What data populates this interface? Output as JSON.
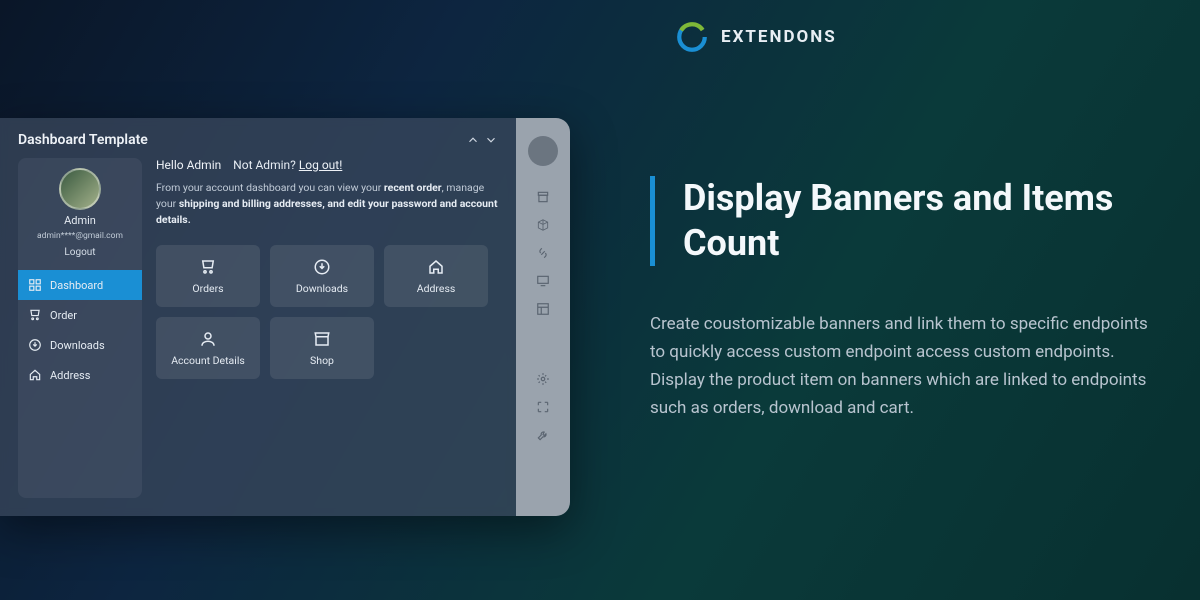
{
  "brand": {
    "name": "EXTENDONS"
  },
  "marketing": {
    "headline": "Display Banners and Items Count",
    "body": "Create coustomizable banners and link them to specific endpoints to quickly access custom endpoint access custom endpoints. Display the product item on banners which are linked to endpoints such as orders, download and cart."
  },
  "panel": {
    "title": "Dashboard Template",
    "profile": {
      "name": "Admin",
      "email": "admin****@gmail.com",
      "logout": "Logout"
    },
    "sidenav": [
      {
        "label": "Dashboard",
        "icon": "grid",
        "active": true
      },
      {
        "label": "Order",
        "icon": "cart",
        "active": false
      },
      {
        "label": "Downloads",
        "icon": "download",
        "active": false
      },
      {
        "label": "Address",
        "icon": "home",
        "active": false
      }
    ],
    "greeting": {
      "hello": "Hello Admin",
      "not_admin": "Not Admin?",
      "logout": "Log out!"
    },
    "description_parts": {
      "p1": "From your account dashboard you can view your ",
      "b1": "recent order",
      "p2": ", manage your ",
      "b2": "shipping and billing addresses, and edit your password and account details."
    },
    "tiles": [
      {
        "label": "Orders",
        "icon": "cart"
      },
      {
        "label": "Downloads",
        "icon": "download"
      },
      {
        "label": "Address",
        "icon": "home"
      },
      {
        "label": "Account Details",
        "icon": "user"
      },
      {
        "label": "Shop",
        "icon": "shop"
      }
    ]
  },
  "rail_icons": [
    "archive",
    "cube",
    "link",
    "monitor",
    "layout",
    "gear",
    "expand",
    "wrench"
  ]
}
